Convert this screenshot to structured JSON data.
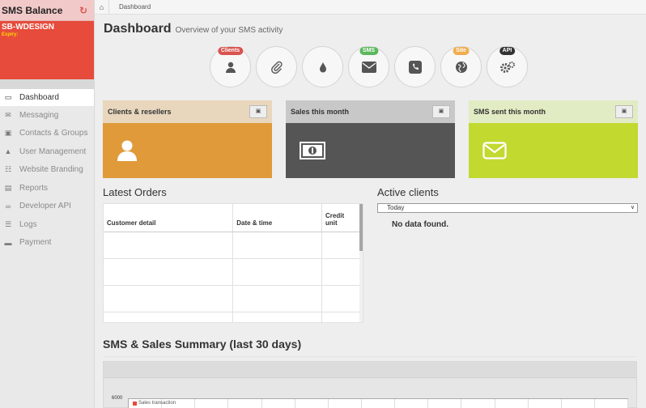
{
  "sidebar": {
    "balance_title": "SMS Balance",
    "account_name": "SB-WDESIGN",
    "expiry_label": "Expiry:",
    "items": [
      {
        "label": "Dashboard",
        "icon": "monitor-icon",
        "active": true
      },
      {
        "label": "Messaging",
        "icon": "envelope-icon"
      },
      {
        "label": "Contacts & Groups",
        "icon": "address-book-icon"
      },
      {
        "label": "User Management",
        "icon": "user-icon"
      },
      {
        "label": "Website Branding",
        "icon": "sitemap-icon"
      },
      {
        "label": "Reports",
        "icon": "chart-icon"
      },
      {
        "label": "Developer API",
        "icon": "link-icon"
      },
      {
        "label": "Logs",
        "icon": "list-icon"
      },
      {
        "label": "Payment",
        "icon": "credit-card-icon"
      }
    ]
  },
  "breadcrumb": {
    "items": [
      "Dashboard"
    ]
  },
  "page": {
    "title": "Dashboard",
    "subtitle": "Overview of your SMS activity"
  },
  "quick_actions": [
    {
      "icon": "user-icon",
      "badge": "Clients",
      "badge_color": "#d9534f"
    },
    {
      "icon": "paperclip-icon",
      "badge": ""
    },
    {
      "icon": "droplet-icon",
      "badge": ""
    },
    {
      "icon": "envelope-icon",
      "badge": "SMS",
      "badge_color": "#5cb85c"
    },
    {
      "icon": "phone-icon",
      "badge": ""
    },
    {
      "icon": "globe-icon",
      "badge": "Site",
      "badge_color": "#f0ad4e"
    },
    {
      "icon": "cogs-icon",
      "badge": "API",
      "badge_color": "#333333"
    }
  ],
  "stats": [
    {
      "title": "Clients & resellers",
      "header_color": "#e8d7bd",
      "body_color": "#e09a3a",
      "icon": "user-icon"
    },
    {
      "title": "Sales this month",
      "header_color": "#c8c8c8",
      "body_color": "#555555",
      "icon": "money-icon"
    },
    {
      "title": "SMS sent this month",
      "header_color": "#e2ecc4",
      "body_color": "#c2d930",
      "icon": "envelope-icon"
    }
  ],
  "latest_orders": {
    "title": "Latest Orders",
    "columns": [
      "Customer detail",
      "Date & time",
      "Credit unit"
    ]
  },
  "active_clients": {
    "title": "Active clients",
    "period": "Today",
    "empty_text": "No data found."
  },
  "summary": {
    "title": "SMS & Sales Summary (last 30 days)",
    "y_tick": "6000",
    "legend": "Sales transaction",
    "legend_color": "#e64b3b"
  }
}
